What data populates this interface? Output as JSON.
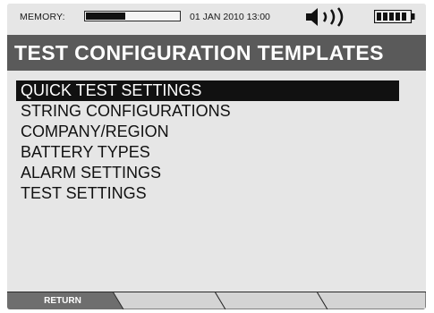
{
  "status_bar": {
    "memory_label": "MEMORY:",
    "memory_fill_fraction": 0.42,
    "datetime": "01 JAN 2010 13:00",
    "speaker_icon": "speaker-volume-icon",
    "battery_icon": "battery-full-icon"
  },
  "title": "TEST CONFIGURATION TEMPLATES",
  "menu": {
    "selected_index": 0,
    "items": [
      "QUICK TEST SETTINGS",
      "STRING CONFIGURATIONS",
      "COMPANY/REGION",
      "BATTERY TYPES",
      "ALARM SETTINGS",
      "TEST SETTINGS"
    ]
  },
  "softkeys": [
    "RETURN",
    "",
    "",
    ""
  ],
  "colors": {
    "title_bar": "#5a5a5a",
    "selection": "#111111",
    "softkey_active": "#6e6e6e",
    "softkey_inactive": "#d4d4d4"
  }
}
